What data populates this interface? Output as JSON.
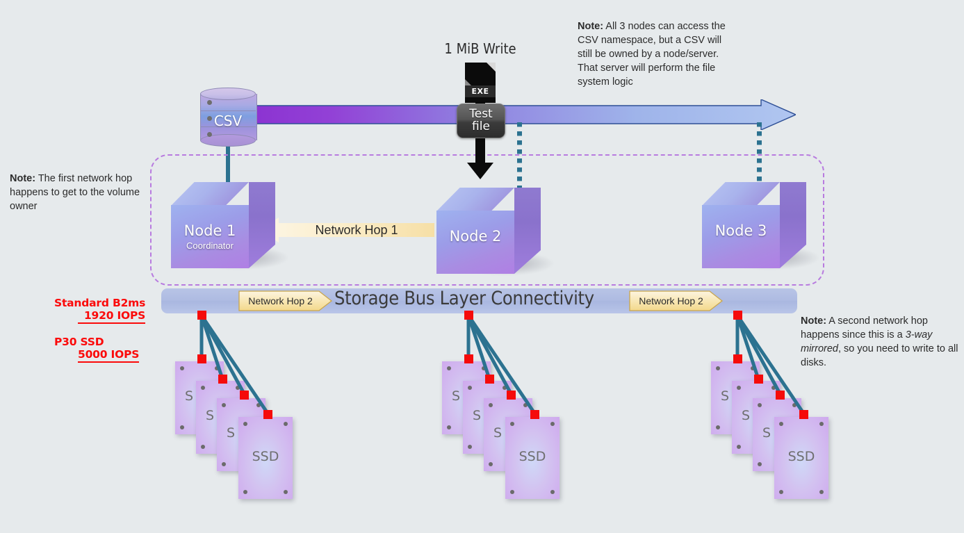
{
  "title": "Storage Spaces Direct write path diagram",
  "background_color": "#e6eaec",
  "labels": {
    "write_size": "1 MiB Write",
    "exe_badge": "EXE",
    "test_file_line1": "Test",
    "test_file_line2": "file",
    "csv": "CSV",
    "bus_title": "Storage Bus Layer Connectivity",
    "hop1": "Network Hop 1",
    "hop2_left": "Network Hop 2",
    "hop2_right": "Network Hop 2",
    "ssd": "SSD",
    "ssd_partial": "S"
  },
  "nodes": [
    {
      "name": "Node 1",
      "sub": "Coordinator"
    },
    {
      "name": "Node 2",
      "sub": ""
    },
    {
      "name": "Node 3",
      "sub": ""
    }
  ],
  "notes": {
    "top_right": {
      "lead": "Note:",
      "text": " All 3 nodes can access the CSV namespace, but a CSV will still be owned by a node/server. That server will perform the file system logic"
    },
    "left": {
      "lead": "Note:",
      "text": " The first network hop happens to get to the volume owner"
    },
    "right": {
      "lead": "Note:",
      "before": " A second network hop happens since this is a ",
      "emphasis": "3-way mirrored",
      "after": ", so you need to write to all disks."
    }
  },
  "perf_annotations": [
    {
      "label": "Standard B2ms",
      "value": "1920 IOPS"
    },
    {
      "label": "P30 SSD",
      "value": "5000 IOPS"
    }
  ],
  "colors": {
    "note_text": "#2b2b2b",
    "red_annotation": "#fb0a0a",
    "cluster_dashed_border": "#b87bdf",
    "arrow_start": "#8a2fd0",
    "arrow_end": "#a9c2ef",
    "arrow_outline": "#2e4f95",
    "hop_fill_start": "#f7e2ae",
    "hop_fill_end": "#fdf4e2",
    "bus_bar": "#aebbe2",
    "connector_teal": "#2c7290",
    "connector_node": "#f50b0b",
    "cube_front": "#9c9ce8",
    "ssd_face": "#cfa9ee"
  }
}
